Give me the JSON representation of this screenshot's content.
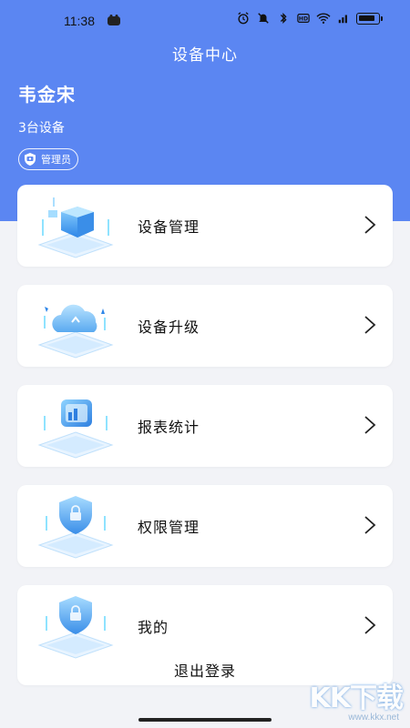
{
  "status_bar": {
    "time": "11:38"
  },
  "header": {
    "title": "设备中心",
    "user_name": "韦金宋",
    "device_count": "3台设备",
    "role": "管理员"
  },
  "menu": {
    "items": [
      {
        "label": "设备管理",
        "icon": "cube-icon"
      },
      {
        "label": "设备升级",
        "icon": "cloud-upgrade-icon"
      },
      {
        "label": "报表统计",
        "icon": "report-chart-icon"
      },
      {
        "label": "权限管理",
        "icon": "shield-lock-icon"
      },
      {
        "label": "我的",
        "icon": "shield-lock-icon"
      }
    ]
  },
  "logout_label": "退出登录",
  "watermark": {
    "text": "KK下载",
    "url": "www.kkx.net"
  },
  "colors": {
    "header_blue": "#5b86f2",
    "page_bg": "#f2f3f7",
    "card_bg": "#ffffff"
  }
}
